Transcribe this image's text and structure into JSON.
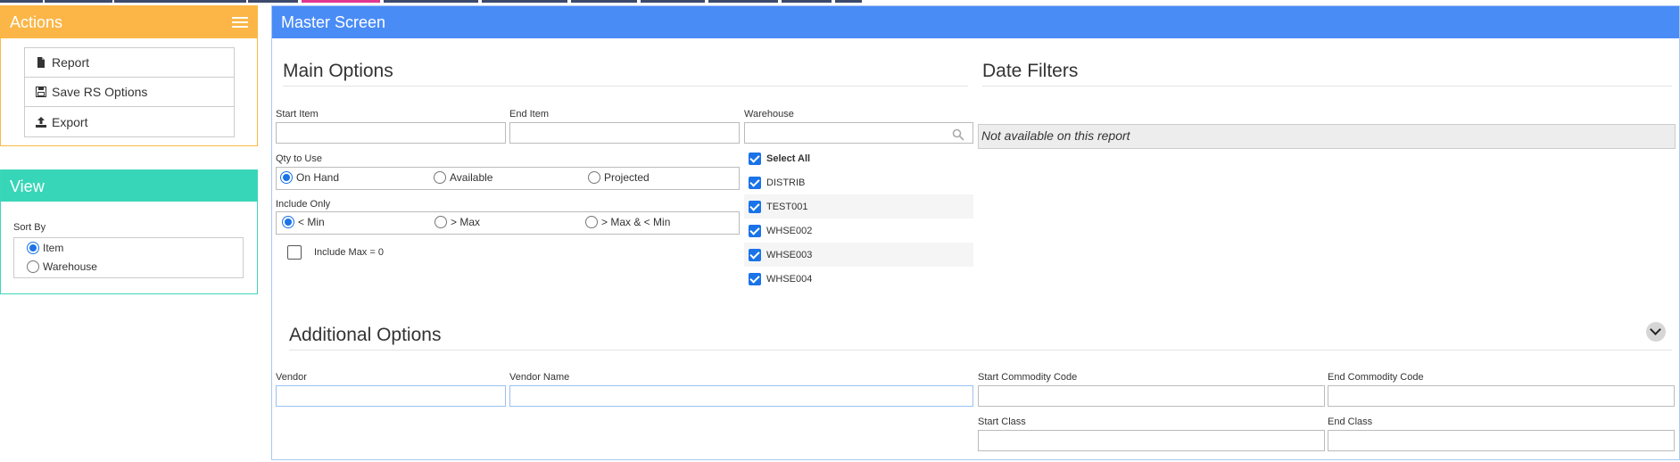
{
  "actions": {
    "title": "Actions",
    "items": [
      {
        "label": "Report",
        "icon": "file-icon"
      },
      {
        "label": "Save RS Options",
        "icon": "save-icon"
      },
      {
        "label": "Export",
        "icon": "upload-icon"
      }
    ]
  },
  "view": {
    "title": "View",
    "sort_by_label": "Sort By",
    "sort_options": [
      {
        "label": "Item",
        "selected": true
      },
      {
        "label": "Warehouse",
        "selected": false
      }
    ]
  },
  "master": {
    "title": "Master Screen",
    "main_options": {
      "title": "Main Options",
      "start_item_label": "Start Item",
      "start_item_value": "",
      "end_item_label": "End Item",
      "end_item_value": "",
      "qty_label": "Qty to Use",
      "qty_options": [
        {
          "label": "On Hand",
          "selected": true
        },
        {
          "label": "Available",
          "selected": false
        },
        {
          "label": "Projected",
          "selected": false
        }
      ],
      "include_only_label": "Include Only",
      "include_options": [
        {
          "label": "< Min",
          "selected": true
        },
        {
          "label": "> Max",
          "selected": false
        },
        {
          "label": "> Max & < Min",
          "selected": false
        }
      ],
      "include_max_zero_label": "Include Max = 0",
      "include_max_zero_checked": false,
      "warehouse_label": "Warehouse",
      "warehouse_search_value": "",
      "warehouse_items": [
        {
          "label": "Select All",
          "checked": true
        },
        {
          "label": "DISTRIB",
          "checked": true
        },
        {
          "label": "TEST001",
          "checked": true
        },
        {
          "label": "WHSE002",
          "checked": true
        },
        {
          "label": "WHSE003",
          "checked": true
        },
        {
          "label": "WHSE004",
          "checked": true
        }
      ]
    },
    "date_filters": {
      "title": "Date Filters",
      "message": "Not available on this report"
    },
    "additional_options": {
      "title": "Additional Options",
      "vendor_label": "Vendor",
      "vendor_value": "",
      "vendor_name_label": "Vendor Name",
      "vendor_name_value": "",
      "start_commodity_label": "Start Commodity Code",
      "start_commodity_value": "",
      "end_commodity_label": "End Commodity Code",
      "end_commodity_value": "",
      "start_class_label": "Start Class",
      "start_class_value": "",
      "end_class_label": "End Class",
      "end_class_value": ""
    }
  },
  "colors": {
    "actions_header": "#fbb647",
    "view_header": "#38d6b8",
    "master_header": "#4a8cf6",
    "accent": "#1a73e8"
  }
}
